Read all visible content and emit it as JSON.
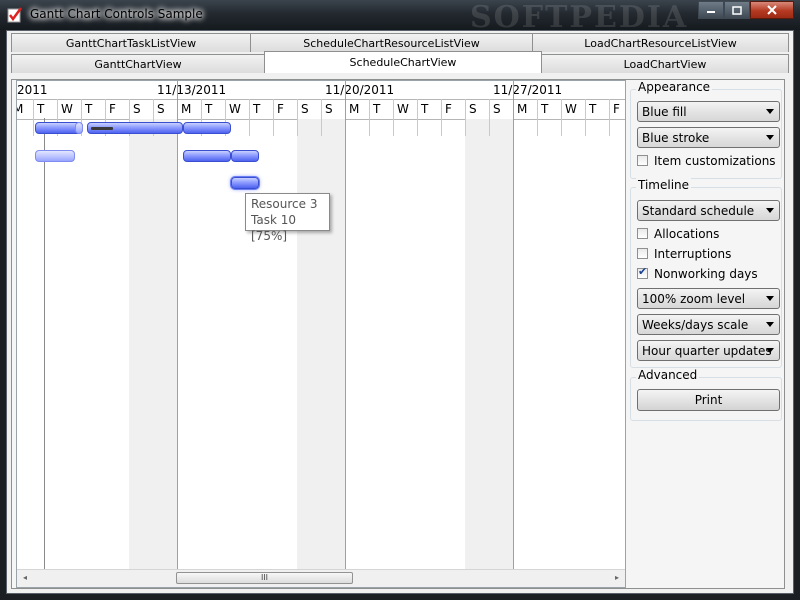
{
  "window": {
    "title": "Gantt Chart Controls Sample",
    "watermark": "SOFTPEDIA",
    "icon": "app-check-icon"
  },
  "tabs_back": [
    "GanttChartTaskListView",
    "ScheduleChartResourceListView",
    "LoadChartResourceListView"
  ],
  "tabs_front": [
    "GanttChartView",
    "ScheduleChartView",
    "LoadChartView"
  ],
  "selected_tab": "ScheduleChartView",
  "timeline": {
    "weeks": [
      "2011",
      "11/13/2011",
      "11/20/2011",
      "11/27/2011"
    ],
    "days": [
      "M",
      "T",
      "W",
      "T",
      "F",
      "S",
      "S",
      "M",
      "T",
      "W",
      "T",
      "F",
      "S",
      "S",
      "M",
      "T",
      "W",
      "T",
      "F",
      "S",
      "S",
      "M",
      "T",
      "W",
      "T",
      "F"
    ]
  },
  "tooltip": {
    "resource": "Resource 3",
    "task": "Task 10 [75%]"
  },
  "scrollbar": {
    "thumb_glyph": "III",
    "left": "◂",
    "right": "▸"
  },
  "appearance": {
    "label": "Appearance",
    "fill": "Blue fill",
    "stroke": "Blue stroke",
    "item_customizations": {
      "label": "Item customizations",
      "checked": false
    }
  },
  "timeline_group": {
    "label": "Timeline",
    "schedule": "Standard schedule",
    "allocations": {
      "label": "Allocations",
      "checked": false
    },
    "interruptions": {
      "label": "Interruptions",
      "checked": false
    },
    "nonworking": {
      "label": "Nonworking days",
      "checked": true
    },
    "zoom": "100% zoom level",
    "scale": "Weeks/days scale",
    "updates": "Hour quarter updates"
  },
  "advanced": {
    "label": "Advanced",
    "print": "Print"
  },
  "colors": {
    "bar": "#4f63f0",
    "bar_light": "#b7c0ff",
    "accent": "#3a4fd0"
  }
}
